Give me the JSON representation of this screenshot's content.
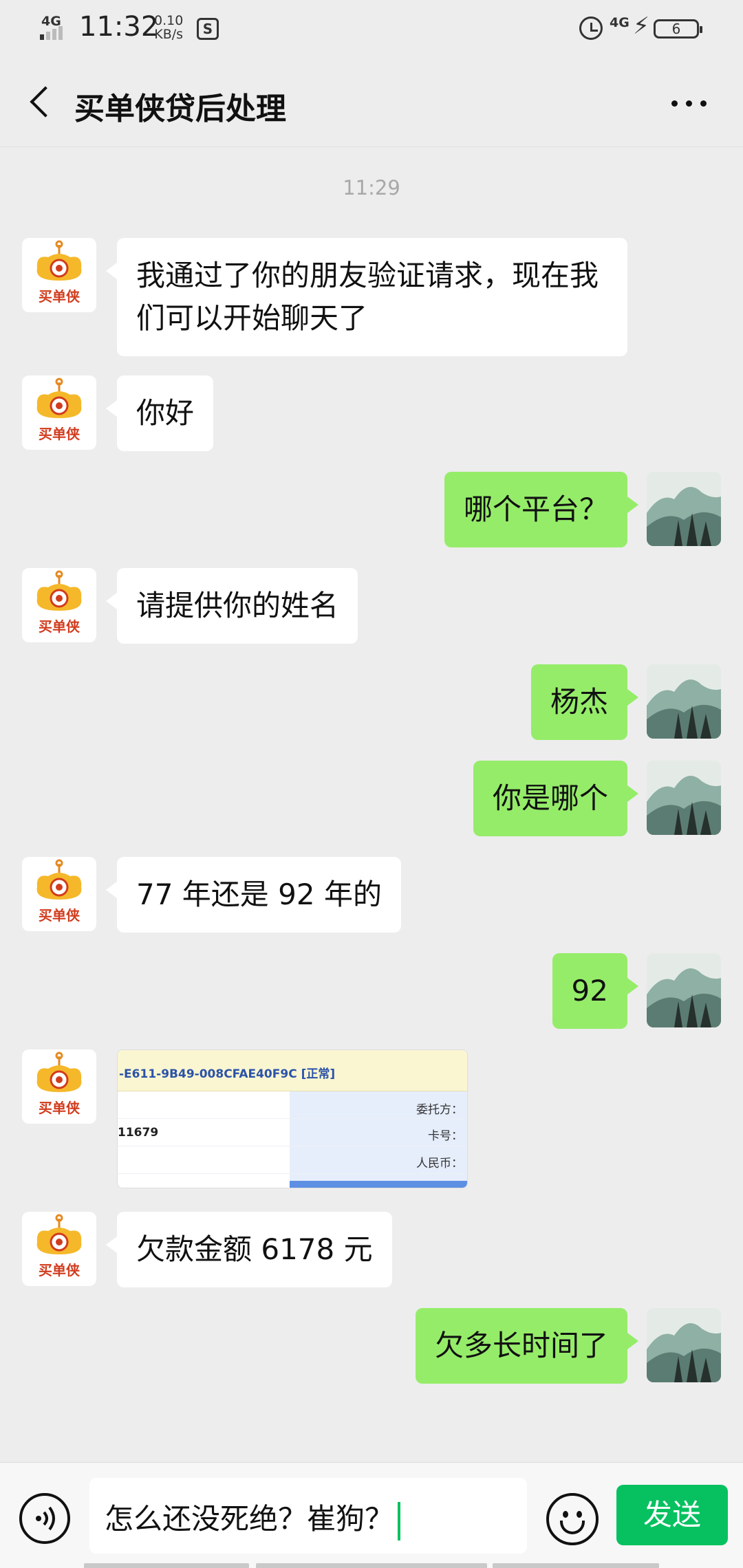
{
  "status_bar": {
    "network_left": "4G",
    "time": "11:32",
    "speed_value": "0.10",
    "speed_unit": "KB/s",
    "network_right": "4G",
    "battery": "6"
  },
  "header": {
    "title": "买单侠贷后处理"
  },
  "chat": {
    "timestamp": "11:29",
    "messages": [
      {
        "side": "left",
        "text": "我通过了你的朋友验证请求，现在我们可以开始聊天了"
      },
      {
        "side": "left",
        "text": "你好"
      },
      {
        "side": "right",
        "text": "哪个平台？"
      },
      {
        "side": "left",
        "text": "请提供你的姓名"
      },
      {
        "side": "right",
        "text": "杨杰"
      },
      {
        "side": "right",
        "text": "你是哪个"
      },
      {
        "side": "left",
        "text": "77 年还是 92 年的"
      },
      {
        "side": "right",
        "text": "92"
      },
      {
        "side": "left",
        "type": "image",
        "image": {
          "header_text": "-E611-9B49-008CFAE40F9C  [正常]",
          "number_text": "11679",
          "labels": [
            "委托方：",
            "卡号：",
            "人民币："
          ]
        }
      },
      {
        "side": "left",
        "text": "欠款金额 6178 元"
      },
      {
        "side": "right",
        "text": "欠多长时间了"
      }
    ],
    "left_avatar_text": "买单侠"
  },
  "input": {
    "value": "怎么还没死绝？崔狗？",
    "send_label": "发送"
  },
  "colors": {
    "accent": "#07c160",
    "bubble_self": "#95ec69",
    "bubble_other": "#ffffff",
    "background": "#ededed"
  },
  "icons": [
    "back-chevron-icon",
    "more-dots-icon",
    "voice-icon",
    "emoji-icon",
    "alarm-icon",
    "charging-bolt-icon",
    "battery-icon"
  ]
}
